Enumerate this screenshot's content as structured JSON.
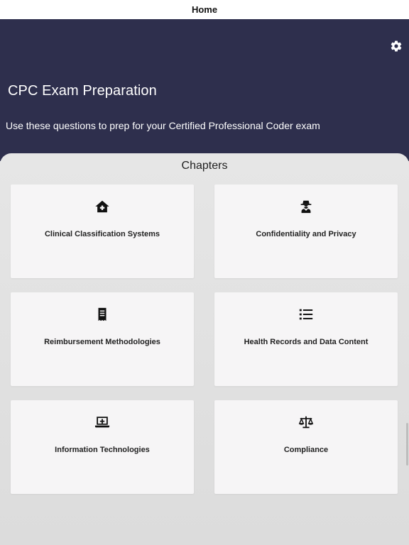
{
  "nav": {
    "title": "Home"
  },
  "hero": {
    "title": "CPC Exam Preparation",
    "subtitle": "Use these questions to prep for your Certified Professional Coder exam",
    "settings_icon": "gear-icon"
  },
  "chapters": {
    "heading": "Chapters",
    "items": [
      {
        "label": "Clinical Classification Systems",
        "icon": "hospital-house-icon"
      },
      {
        "label": "Confidentiality and Privacy",
        "icon": "user-secret-icon"
      },
      {
        "label": "Reimbursement Methodologies",
        "icon": "receipt-icon"
      },
      {
        "label": "Health Records and Data Content",
        "icon": "list-icon"
      },
      {
        "label": "Information Technologies",
        "icon": "laptop-medical-icon"
      },
      {
        "label": "Compliance",
        "icon": "balance-scale-icon"
      }
    ]
  },
  "colors": {
    "hero_bg": "#2e2f4d",
    "card_bg": "#f6f5f6",
    "content_bg": "#e4e4e4"
  }
}
